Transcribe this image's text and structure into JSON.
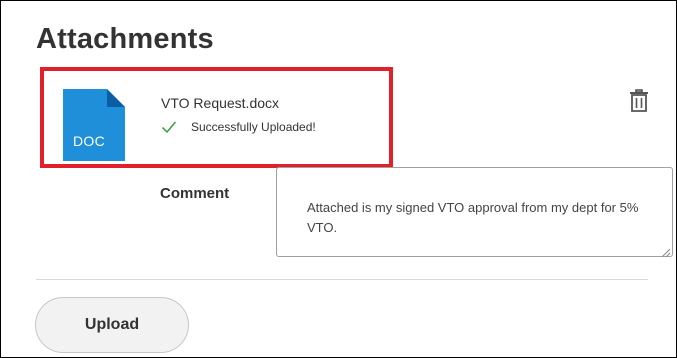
{
  "section": {
    "title": "Attachments"
  },
  "attachment": {
    "file_type": "DOC",
    "file_name": "VTO Request.docx",
    "status": "Successfully Uploaded!",
    "icons": {
      "file": "doc-file-icon",
      "status": "checkmark-icon",
      "delete": "trash-icon"
    }
  },
  "comment": {
    "label": "Comment",
    "value": "Attached is my signed VTO approval from my dept for 5% VTO."
  },
  "actions": {
    "upload_label": "Upload"
  },
  "colors": {
    "highlight": "#e2202c",
    "doc_icon": "#1e8fd8",
    "doc_fold": "#0b5ea3",
    "check": "#43a047"
  }
}
